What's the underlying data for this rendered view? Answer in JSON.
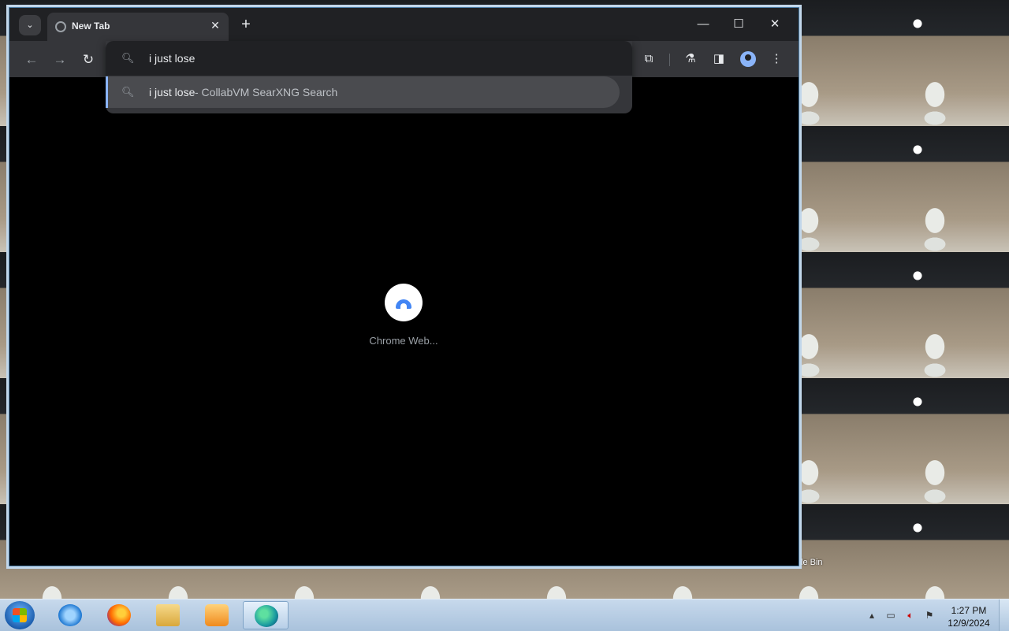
{
  "browser": {
    "tab": {
      "title": "New Tab"
    },
    "window_controls": {
      "minimize": "—",
      "maximize": "☐",
      "close": "✕"
    }
  },
  "omnibox": {
    "value": "i just lose ",
    "suggestion": {
      "query": "i just lose",
      "description": "- CollabVM SearXNG Search"
    }
  },
  "content": {
    "shortcut_label": "Chrome Web..."
  },
  "desktop": {
    "recycle_bin_label": "le Bin"
  },
  "taskbar": {
    "clock_time": "1:27 PM",
    "clock_date": "12/9/2024"
  },
  "icons": [
    "tab-search-icon",
    "globe-icon",
    "close-icon",
    "plus-icon",
    "back-icon",
    "forward-icon",
    "reload-icon",
    "search-icon",
    "extensions-icon",
    "labs-icon",
    "side-panel-icon",
    "profile-icon",
    "menu-icon",
    "windows-start-icon",
    "internet-explorer-icon",
    "firefox-icon",
    "file-explorer-icon",
    "media-player-icon",
    "edge-icon"
  ],
  "colors": {
    "accent": "#8ab4f8",
    "toolbar": "#35363a",
    "frame": "#202124"
  }
}
